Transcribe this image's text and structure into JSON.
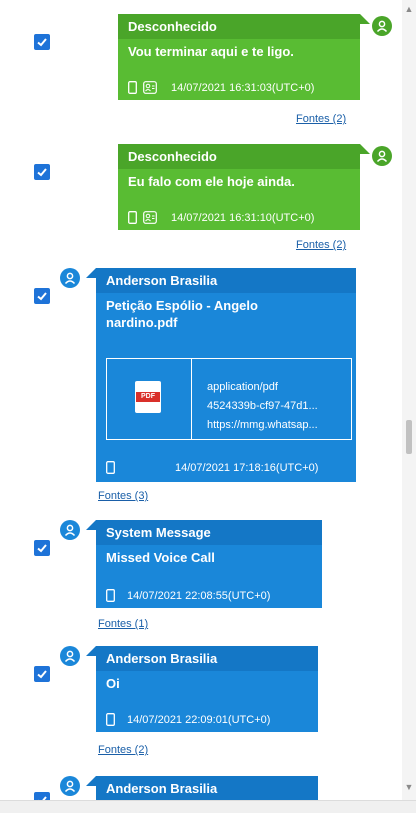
{
  "messages": [
    {
      "sender": "Desconhecido",
      "text": "Vou terminar aqui e te ligo.",
      "timestamp": "14/07/2021 16:31:03(UTC+0)",
      "sources": "Fontes (2)",
      "checked": true,
      "direction": "incoming-right",
      "color": "#59bc33"
    },
    {
      "sender": "Desconhecido",
      "text": "Eu falo com ele hoje ainda.",
      "timestamp": "14/07/2021 16:31:10(UTC+0)",
      "sources": "Fontes (2)",
      "checked": true,
      "direction": "incoming-right",
      "color": "#59bc33"
    },
    {
      "sender": "Anderson Brasilia",
      "text": "Petição Espólio - Angelo nardino.pdf",
      "attachment": {
        "mime": "application/pdf",
        "hash": "4524339b-cf97-47d1...",
        "url": "https://mmg.whatsap...",
        "icon_label": "PDF"
      },
      "timestamp": "14/07/2021 17:18:16(UTC+0)",
      "sources": "Fontes (3)",
      "checked": true,
      "direction": "outgoing-left",
      "color": "#1a87d9"
    },
    {
      "sender": "System Message",
      "text": "Missed Voice Call",
      "timestamp": "14/07/2021 22:08:55(UTC+0)",
      "sources": "Fontes (1)",
      "checked": true,
      "direction": "outgoing-left",
      "color": "#1a87d9"
    },
    {
      "sender": "Anderson Brasilia",
      "text": "Oi",
      "timestamp": "14/07/2021 22:09:01(UTC+0)",
      "sources": "Fontes (2)",
      "checked": true,
      "direction": "outgoing-left",
      "color": "#1a87d9"
    },
    {
      "sender": "Anderson Brasilia",
      "checked": true,
      "direction": "outgoing-left",
      "color": "#1a87d9"
    }
  ]
}
